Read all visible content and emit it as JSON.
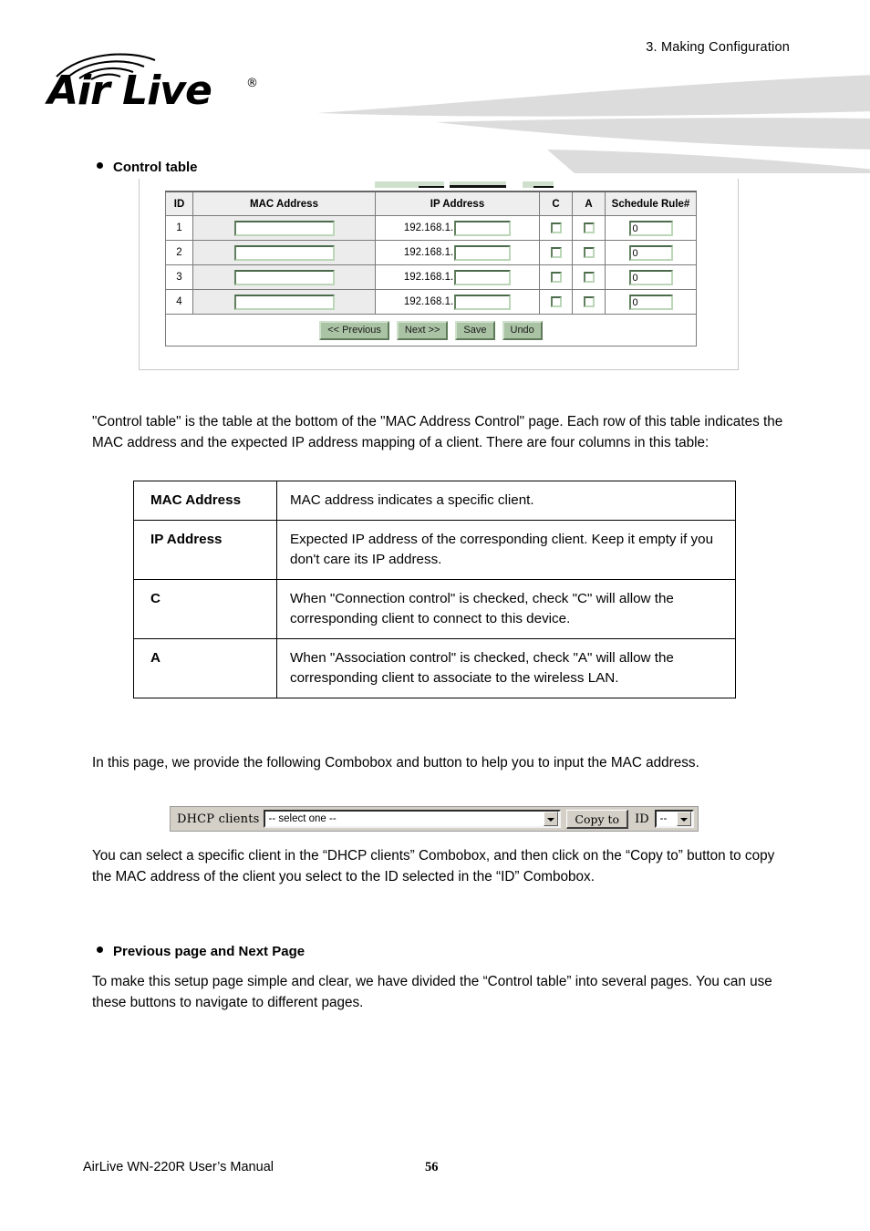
{
  "header": {
    "chapter": "3.  Making  Configuration",
    "logo_text": "Air Live",
    "logo_reg": "®"
  },
  "sections": {
    "control_table_heading": "Control table",
    "paragraph_1": "\"Control table\" is the table at the bottom of the \"MAC Address Control\" page. Each row of this table indicates the MAC address and the expected IP address mapping of a client. There are four columns in this table:",
    "paragraph_2": "In this page, we provide the following Combobox and button to help you to input the MAC address.",
    "paragraph_3": "You can select a specific client in the “DHCP clients” Combobox, and then click on the “Copy to” button to copy the MAC address of the client you select to the ID selected in the “ID” Combobox.",
    "prev_next_heading": "Previous page and Next Page",
    "paragraph_4": "To make this setup page simple and clear, we have divided the “Control table” into several pages. You can use these buttons to navigate to different pages."
  },
  "control_table": {
    "columns": [
      "ID",
      "MAC Address",
      "IP Address",
      "C",
      "A",
      "Schedule Rule#"
    ],
    "ip_prefix": "192.168.1.",
    "rows": [
      {
        "id": "1",
        "mac": "",
        "ip": "",
        "c": false,
        "a": false,
        "schedule_rule": "0"
      },
      {
        "id": "2",
        "mac": "",
        "ip": "",
        "c": false,
        "a": false,
        "schedule_rule": "0"
      },
      {
        "id": "3",
        "mac": "",
        "ip": "",
        "c": false,
        "a": false,
        "schedule_rule": "0"
      },
      {
        "id": "4",
        "mac": "",
        "ip": "",
        "c": false,
        "a": false,
        "schedule_rule": "0"
      }
    ],
    "buttons": {
      "previous": "<< Previous",
      "next": "Next >>",
      "save": "Save",
      "undo": "Undo"
    },
    "colors": {
      "button_face": "#aac3a4",
      "field_border_dark": "#4b6b4b",
      "field_border_light": "#bcd6b8",
      "header_bg": "#eeeeee",
      "mac_cell_bg": "#ececec"
    }
  },
  "definition_table": {
    "rows": [
      {
        "term": "MAC Address",
        "description": "MAC address indicates a specific client."
      },
      {
        "term": "IP Address",
        "description": "Expected IP address of the corresponding client. Keep it empty if you don't care its IP address."
      },
      {
        "term": "C",
        "description": "When \"Connection control\" is checked, check \"C\" will allow the corresponding client to connect to this device."
      },
      {
        "term": "A",
        "description": "When \"Association control\" is checked, check \"A\" will allow the corresponding client to associate to the wireless LAN."
      }
    ]
  },
  "dhcp_widget": {
    "label": "DHCP clients",
    "select_value": "-- select one --",
    "copy_button": "Copy to",
    "id_label": "ID",
    "id_select_value": "--"
  },
  "footer": {
    "manual": "AirLive WN-220R User’s Manual",
    "page_number": "56"
  }
}
